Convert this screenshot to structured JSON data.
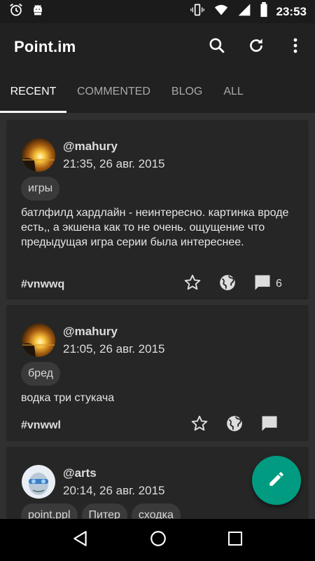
{
  "status_bar": {
    "left_icons": [
      "alarm-icon",
      "android-debug-icon"
    ],
    "right_icons": [
      "vibrate-icon",
      "wifi-icon",
      "signal-icon",
      "battery-icon"
    ],
    "time": "23:53"
  },
  "app_bar": {
    "title": "Point.im",
    "actions": [
      "search-icon",
      "refresh-icon",
      "more-vert-icon"
    ]
  },
  "tabs": [
    {
      "label": "RECENT",
      "active": true
    },
    {
      "label": "COMMENTED",
      "active": false
    },
    {
      "label": "BLOG",
      "active": false
    },
    {
      "label": "ALL",
      "active": false
    }
  ],
  "posts": [
    {
      "author": "@mahury",
      "date": "21:35, 26 авг. 2015",
      "tags": [
        "игры"
      ],
      "text": "батлфилд хардлайн  - неинтересно. картинка вроде есть,, а экшена как то не очень. ощущение что предыдущая игра серии была интереснее.",
      "id": "#vnwwq",
      "comment_count": "6"
    },
    {
      "author": "@mahury",
      "date": "21:05, 26 авг. 2015",
      "tags": [
        "бред"
      ],
      "text": "водка три стукача",
      "id": "#vnwwl",
      "comment_count": ""
    },
    {
      "author": "@arts",
      "date": "20:14, 26 авг. 2015",
      "tags": [
        "point.ppl",
        "Питер",
        "сходка"
      ],
      "text": "",
      "id": "",
      "comment_count": ""
    }
  ],
  "fab": {
    "icon": "edit-pencil-icon"
  },
  "nav_bar": {
    "icons": [
      "back-icon",
      "home-icon",
      "recents-icon"
    ]
  },
  "colors": {
    "background": "#303030",
    "card": "#262626",
    "toolbar": "#212121",
    "tag": "#3a3a3a",
    "fab": "#009b80"
  }
}
